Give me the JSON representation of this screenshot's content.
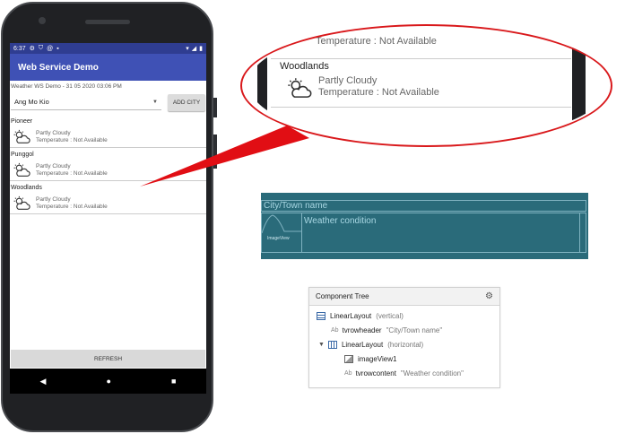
{
  "phone": {
    "status": {
      "time": "6:37",
      "icons_left": [
        "gear-icon",
        "shield-icon",
        "at-icon",
        "sd-icon"
      ],
      "icons_right": [
        "wifi-icon",
        "signal-icon",
        "battery-icon"
      ]
    },
    "app_title": "Web Service Demo",
    "subtitle": "Weather WS Demo - 31 05 2020 03:06 PM",
    "spinner_value": "Ang Mo Kio",
    "add_city_label": "ADD CITY",
    "cities": [
      {
        "name": "Pioneer",
        "condition": "Partly Cloudy",
        "temperature": "Temperature : Not Available"
      },
      {
        "name": "Punggol",
        "condition": "Partly Cloudy",
        "temperature": "Temperature : Not Available"
      },
      {
        "name": "Woodlands",
        "condition": "Partly Cloudy",
        "temperature": "Temperature : Not Available"
      }
    ],
    "refresh_label": "REFRESH",
    "nav": {
      "back": "◀",
      "home": "●",
      "recents": "■"
    }
  },
  "zoom": {
    "partial_temperature": "Temperature : Not Available",
    "city": "Woodlands",
    "condition": "Partly Cloudy",
    "temperature": "Temperature : Not Available"
  },
  "design_preview": {
    "header": "City/Town name",
    "image_label": "ImageView",
    "content": "Weather condition"
  },
  "component_tree": {
    "title": "Component Tree",
    "items": [
      {
        "name": "LinearLayout",
        "detail": "(vertical)"
      },
      {
        "prefix": "Ab",
        "name": "tvrowheader",
        "detail": "\"City/Town name\""
      },
      {
        "name": "LinearLayout",
        "detail": "(horizontal)"
      },
      {
        "name": "imageView1",
        "detail": ""
      },
      {
        "prefix": "Ab",
        "name": "tvrowcontent",
        "detail": "\"Weather condition\""
      }
    ]
  },
  "colors": {
    "app_bar": "#3f51b5",
    "status_bar": "#2f3d91",
    "callout": "#e10e14",
    "design_bg": "#2a6b7a"
  }
}
